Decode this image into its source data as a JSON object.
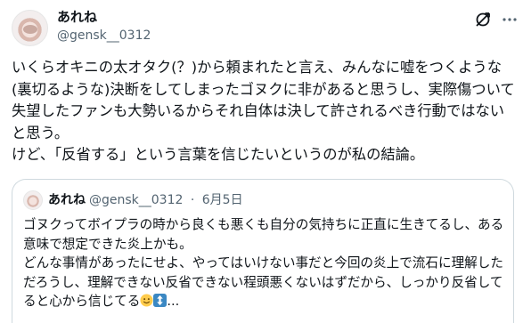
{
  "author": {
    "name": "あれね",
    "handle": "@gensk__0312"
  },
  "icons": [
    "avatar",
    "grok-icon",
    "more-icon",
    "smiley-emoji",
    "up-down-arrow-emoji"
  ],
  "tweet": {
    "text": "いくらオキニの太オタク(？)から頼まれたと言え、みんなに嘘をつくような(裏切るような)決断をしてしまったゴヌクに非があると思うし、実際傷ついて失望したファンも大勢いるからそれ自体は決して許されるべき行動ではないと思う。\nけど、「反省する」という言葉を信じたいというのが私の結論。"
  },
  "quote": {
    "name": "あれね",
    "handle": "@gensk__0312",
    "separator": "·",
    "date": "6月5日",
    "text": "ゴヌクってボイプラの時から良くも悪くも自分の気持ちに正直に生きてるし、ある意味で想定できた炎上かも。\nどんな事情があったにせよ、やってはいけない事だと今回の炎上で流石に理解しただろうし、理解できない反省できない程頭悪くないはずだから、しっかり反省してると心から信じてる",
    "ellipsis": "..."
  }
}
